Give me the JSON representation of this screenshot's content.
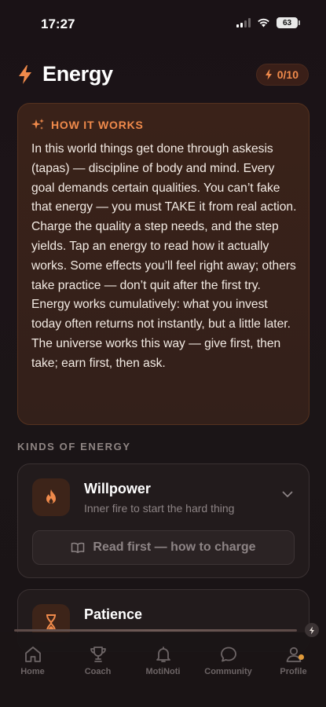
{
  "status_bar": {
    "time": "17:27",
    "battery": "63"
  },
  "header": {
    "title": "Energy",
    "counter": "0/10"
  },
  "how_it_works": {
    "title": "HOW IT WORKS",
    "body": "In this world things get done through askesis (tapas) — discipline of body and mind. Every goal demands certain qualities. You can’t fake that energy — you must TAKE it from real action. Charge the quality a step needs, and the step yields. Tap an energy to read how it actually works. Some effects you’ll feel right away; others take practice — don’t quit after the first try. Energy works cumulatively: what you invest today often returns not instantly, but a little later. The universe works this way — give first, then take; earn first, then ask."
  },
  "kinds_label": "KINDS OF ENERGY",
  "energies": [
    {
      "name": "Willpower",
      "subtitle": "Inner fire to start the hard thing",
      "icon": "flame-icon",
      "action_label": "Read first — how to charge"
    },
    {
      "name": "Patience",
      "subtitle": "",
      "icon": "hourglass-icon"
    }
  ],
  "tabs": [
    {
      "label": "Home",
      "icon": "home-icon"
    },
    {
      "label": "Coach",
      "icon": "trophy-icon"
    },
    {
      "label": "MotiNoti",
      "icon": "bell-icon"
    },
    {
      "label": "Community",
      "icon": "chat-icon"
    },
    {
      "label": "Profile",
      "icon": "profile-icon"
    }
  ],
  "colors": {
    "accent": "#f08a4b",
    "background": "#1a1416",
    "card": "#221b1c",
    "how_card": "#3a2219"
  }
}
